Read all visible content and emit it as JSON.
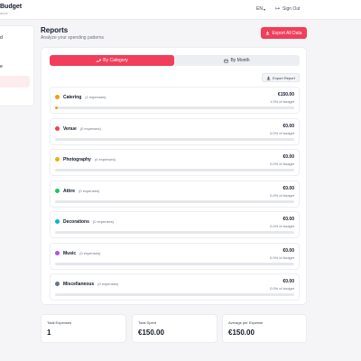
{
  "header": {
    "brand_title": "Budget",
    "brand_subtitle": "ance",
    "language": "EN",
    "signout": "Sign Out"
  },
  "sidebar": {
    "items": [
      {
        "label": "d"
      },
      {
        "label": "e"
      }
    ]
  },
  "page": {
    "title": "Reports",
    "subtitle": "Analyze your spending patterns",
    "export_all": "Export All Data"
  },
  "tabs": [
    {
      "label": "By Category",
      "icon": "trend-icon",
      "active": true
    },
    {
      "label": "By Month",
      "icon": "calendar-icon",
      "active": false
    }
  ],
  "export_report": "Export Report",
  "categories": [
    {
      "name": "Catering",
      "count": "(1 expenses)",
      "amount": "€150.00",
      "pct_text": "1.0% of budget",
      "fraction": 0.01,
      "color": "#f59e0b"
    },
    {
      "name": "Venue",
      "count": "(0 expenses)",
      "amount": "€0.00",
      "pct_text": "0.0% of budget",
      "fraction": 0,
      "color": "#ef4444"
    },
    {
      "name": "Photography",
      "count": "(0 expenses)",
      "amount": "€0.00",
      "pct_text": "0.0% of budget",
      "fraction": 0,
      "color": "#eab308"
    },
    {
      "name": "Attire",
      "count": "(0 expenses)",
      "amount": "€0.00",
      "pct_text": "0.0% of budget",
      "fraction": 0,
      "color": "#22c55e"
    },
    {
      "name": "Decorations",
      "count": "(0 expenses)",
      "amount": "€0.00",
      "pct_text": "0.0% of budget",
      "fraction": 0,
      "color": "#06b6d4"
    },
    {
      "name": "Music",
      "count": "(0 expenses)",
      "amount": "€0.00",
      "pct_text": "0.0% of budget",
      "fraction": 0,
      "color": "#a855f7"
    },
    {
      "name": "Miscellaneous",
      "count": "(0 expenses)",
      "amount": "€0.00",
      "pct_text": "0.0% of budget",
      "fraction": 0,
      "color": "#64748b"
    }
  ],
  "stats": [
    {
      "label": "Total Expenses",
      "value": "1"
    },
    {
      "label": "Total Spent",
      "value": "€150.00"
    },
    {
      "label": "Average per Expense",
      "value": "€150.00"
    }
  ],
  "colors": {
    "accent": "#f03e5b",
    "fill": "#f59e0b"
  }
}
